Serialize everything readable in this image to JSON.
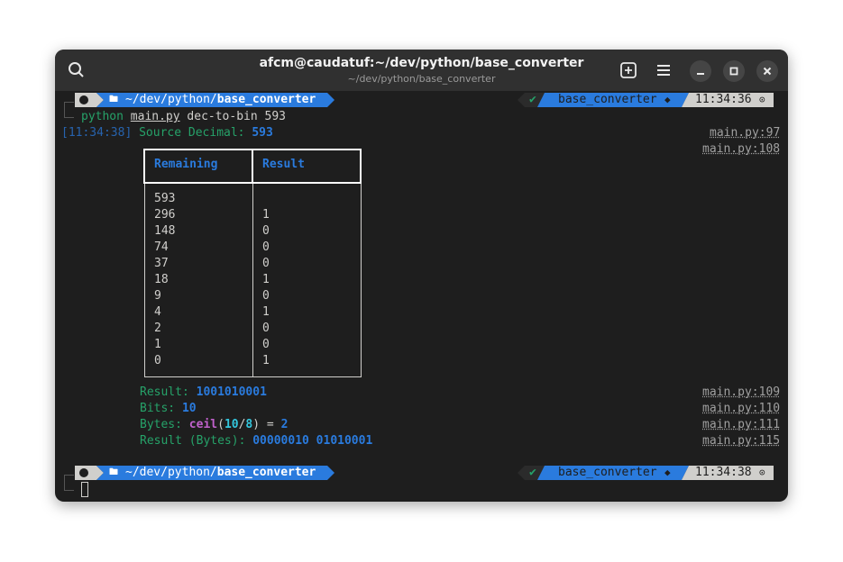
{
  "window": {
    "title": "afcm@caudatuf:~/dev/python/base_converter",
    "subtitle": "~/dev/python/base_converter"
  },
  "prompt": {
    "path_prefix": "~/dev/python/",
    "path_dir": "base_converter",
    "git_branch": "base_converter",
    "time_1": "11:34:36",
    "time_2": "11:34:38",
    "check": "✔",
    "clock_icon": "⊙",
    "branch_icon": "◆",
    "folder_icon": "🖿"
  },
  "command": {
    "program": "python",
    "file": "main.py",
    "args": "dec-to-bin 593"
  },
  "log": {
    "timestamp": "[11:34:38]",
    "source_label": "Source Decimal:",
    "source_value": "593",
    "ref_97": "main.py:97",
    "ref_108": "main.py:108",
    "ref_109": "main.py:109",
    "ref_110": "main.py:110",
    "ref_111": "main.py:111",
    "ref_115": "main.py:115"
  },
  "table": {
    "headers": [
      "Remaining",
      "Result"
    ],
    "remaining": [
      "593",
      "296",
      "148",
      "74",
      "37",
      "18",
      "9",
      "4",
      "2",
      "1",
      "0"
    ],
    "result": [
      "",
      "1",
      "0",
      "0",
      "0",
      "1",
      "0",
      "1",
      "0",
      "0",
      "1"
    ]
  },
  "results": {
    "result_label": "Result:",
    "result_value": "1001010001",
    "bits_label": "Bits:",
    "bits_value": "10",
    "bytes_label": "Bytes:",
    "bytes_fn": "ceil",
    "bytes_open": "(",
    "bytes_num": "10",
    "bytes_div": "/",
    "bytes_den": "8",
    "bytes_close": ")",
    "bytes_eq": " = ",
    "bytes_value": "2",
    "result_bytes_label": "Result (Bytes):",
    "result_bytes_value": "00000010 01010001"
  },
  "colors": {
    "accent_blue": "#2a7bde",
    "green": "#26a269",
    "purple": "#c061cb",
    "cyan": "#33c7de"
  },
  "icons": [
    "search-icon",
    "new-tab-icon",
    "menu-icon",
    "minimize-icon",
    "maximize-icon",
    "close-icon"
  ]
}
